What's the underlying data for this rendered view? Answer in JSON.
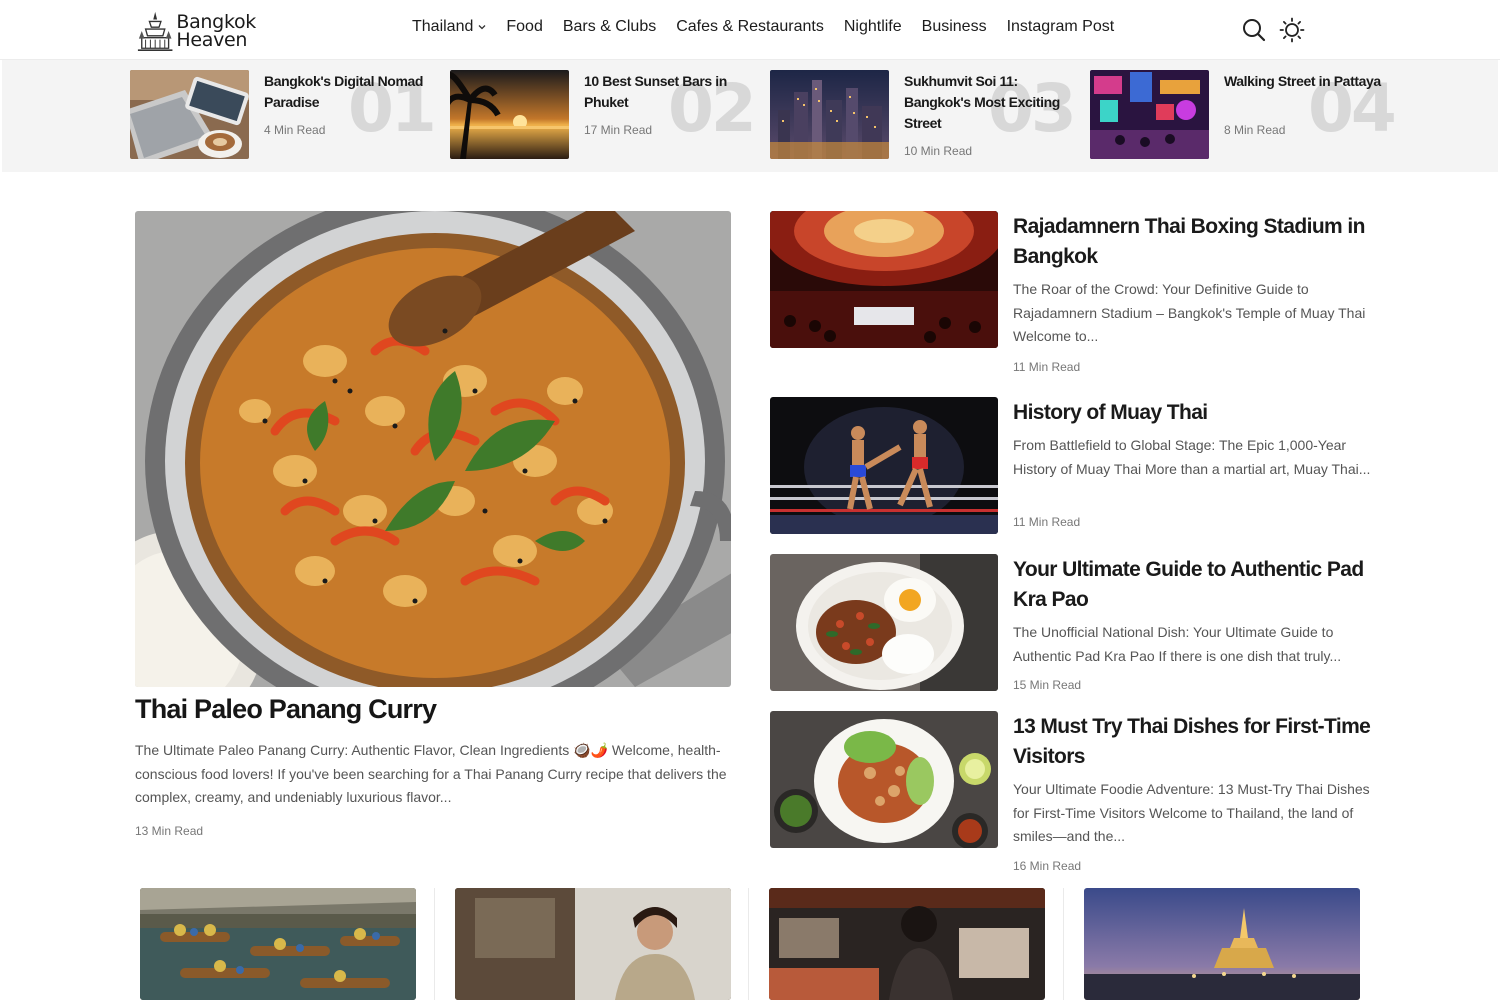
{
  "site": {
    "logo_line1": "Bangkok",
    "logo_line2": "Heaven"
  },
  "nav": {
    "items": [
      {
        "label": "Thailand",
        "has_dropdown": true
      },
      {
        "label": "Food"
      },
      {
        "label": "Bars & Clubs"
      },
      {
        "label": "Cafes & Restaurants"
      },
      {
        "label": "Nightlife"
      },
      {
        "label": "Business"
      },
      {
        "label": "Instagram Post"
      }
    ],
    "icons": [
      "search-icon",
      "theme-toggle-sun-icon"
    ]
  },
  "trending": [
    {
      "num": "01",
      "title": "Bangkok's Digital Nomad Paradise",
      "meta": "4 Min Read"
    },
    {
      "num": "02",
      "title": "10 Best Sunset Bars in Phuket",
      "meta": "17 Min Read"
    },
    {
      "num": "03",
      "title": "Sukhumvit Soi 11: Bangkok's Most Exciting Street",
      "meta": "10 Min Read"
    },
    {
      "num": "04",
      "title": "Walking Street in Pattaya",
      "meta": "8 Min Read"
    }
  ],
  "featured": {
    "title": "Thai Paleo Panang Curry",
    "excerpt": "The Ultimate Paleo Panang Curry: Authentic Flavor, Clean Ingredients 🥥🌶️ Welcome, health-conscious food lovers! If you've been searching for a Thai Panang Curry recipe that delivers the complex, creamy, and undeniably luxurious flavor...",
    "meta": "13 Min Read"
  },
  "side_posts": [
    {
      "title": "Rajadamnern Thai Boxing Stadium in Bangkok",
      "excerpt": "The Roar of the Crowd: Your Definitive Guide to Rajadamnern Stadium – Bangkok's Temple of Muay Thai Welcome to...",
      "meta": "11 Min Read"
    },
    {
      "title": "History of Muay Thai",
      "excerpt": "From Battlefield to Global Stage: The Epic 1,000-Year History of Muay Thai More than a martial art, Muay Thai...",
      "meta": "11 Min Read"
    },
    {
      "title": "Your Ultimate Guide to Authentic Pad Kra Pao",
      "excerpt": "The Unofficial National Dish: Your Ultimate Guide to Authentic Pad Kra Pao If there is one dish that truly...",
      "meta": "15 Min Read"
    },
    {
      "title": "13 Must Try Thai Dishes for First-Time Visitors",
      "excerpt": "Your Ultimate Foodie Adventure: 13 Must-Try Thai Dishes for First-Time Visitors Welcome to Thailand, the land of smiles—and the...",
      "meta": "16 Min Read"
    }
  ],
  "colors": {
    "text": "#1a1a1a",
    "muted": "#777777",
    "strip_bg": "#f4f4f4",
    "number_watermark": "#d8d8d8"
  }
}
